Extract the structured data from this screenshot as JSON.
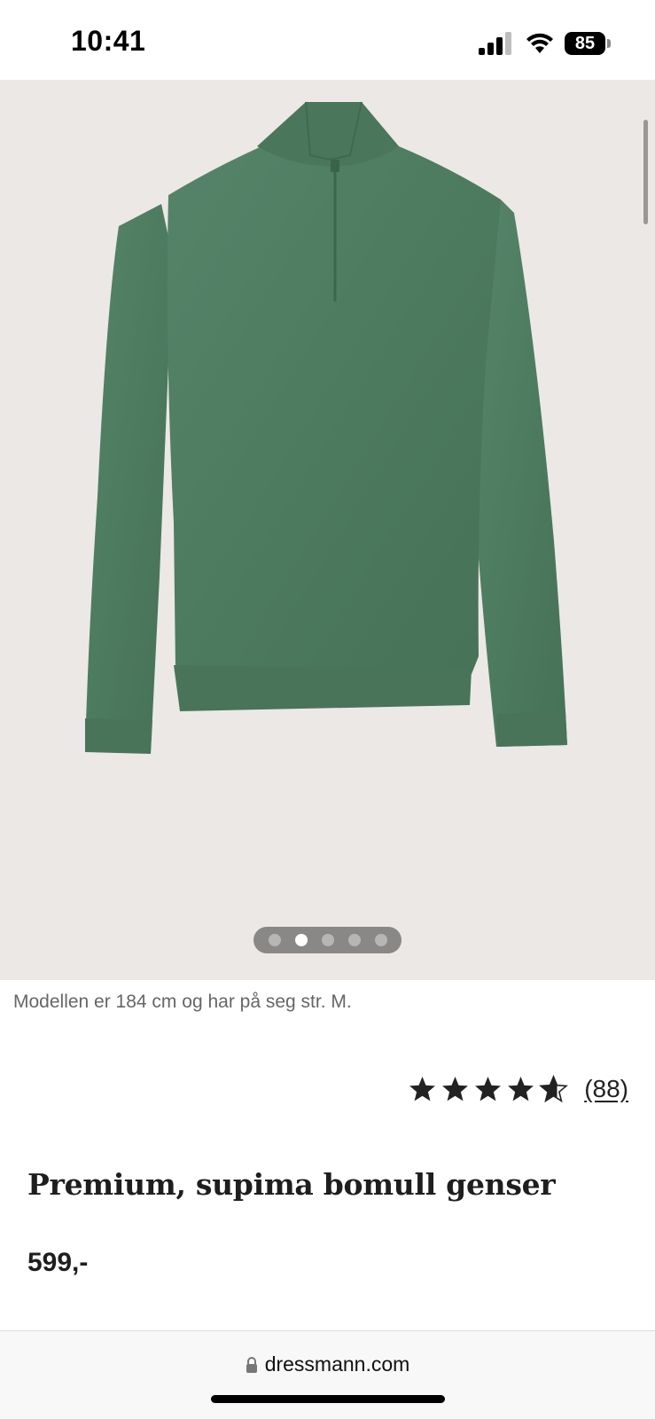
{
  "status_bar": {
    "time": "10:41",
    "battery": "85",
    "icons": [
      "signal-icon",
      "wifi-icon",
      "battery-icon"
    ]
  },
  "product": {
    "image_carousel": {
      "count": 5,
      "active_index": 1,
      "background_color": "#ece8e5",
      "garment_color": "#4e7a5c"
    },
    "model_caption": "Modellen er 184 cm og har på seg str. M.",
    "rating": {
      "stars": 4.5,
      "count_label": "(88)"
    },
    "title": "Premium, supima bomull genser",
    "price": "599,-"
  },
  "browser": {
    "url": "dressmann.com",
    "lock_icon": "lock-icon"
  }
}
